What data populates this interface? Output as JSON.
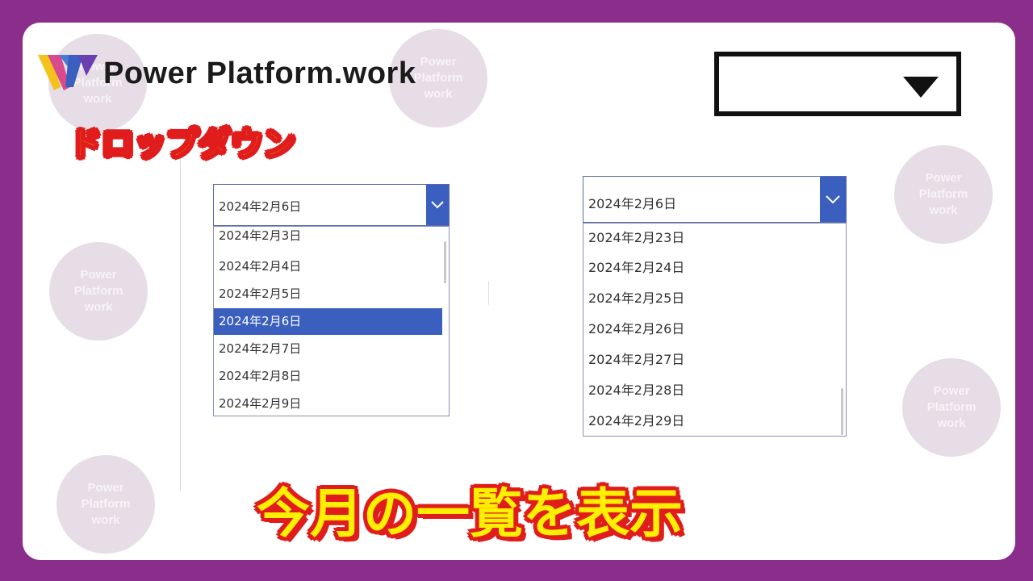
{
  "brand": {
    "name": "Power Platform.work"
  },
  "watermark": {
    "line1": "Power",
    "line2": "Platform",
    "line3": "work"
  },
  "tag": "ドロップダウン",
  "caption": "今月の一覧を表示",
  "dropdown1": {
    "value": "2024年2月6日",
    "options": [
      "2024年2月3日",
      "2024年2月4日",
      "2024年2月5日",
      "2024年2月6日",
      "2024年2月7日",
      "2024年2月8日",
      "2024年2月9日"
    ],
    "selected_index": 3
  },
  "dropdown2": {
    "value": "2024年2月6日",
    "options": [
      "2024年2月23日",
      "2024年2月24日",
      "2024年2月25日",
      "2024年2月26日",
      "2024年2月27日",
      "2024年2月28日",
      "2024年2月29日"
    ]
  },
  "colors": {
    "frame": "#8b2d8b",
    "accent": "#3a5fbf",
    "caption_fill": "#ffef00",
    "caption_stroke": "#e01c1c"
  }
}
